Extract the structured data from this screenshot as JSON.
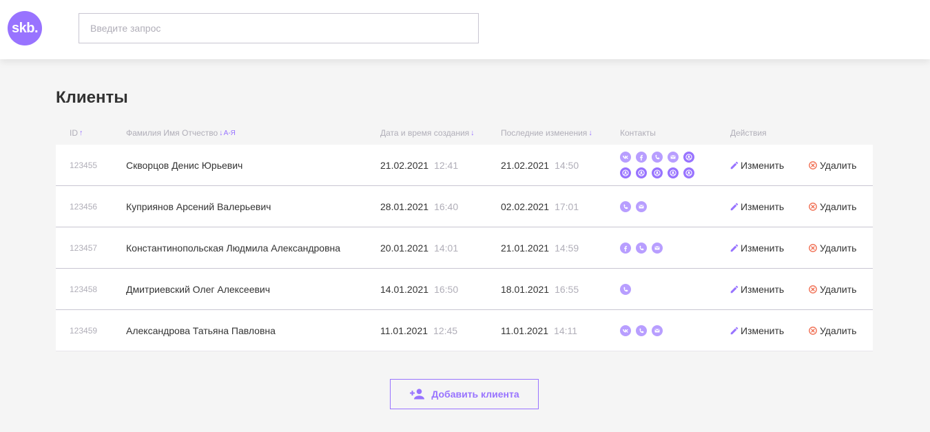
{
  "header": {
    "logo_text": "skb.",
    "search_placeholder": "Введите запрос"
  },
  "page": {
    "title": "Клиенты"
  },
  "table": {
    "columns": {
      "id": "ID",
      "name": "Фамилия Имя Отчество",
      "name_sort_hint": "А-Я",
      "created": "Дата и время создания",
      "updated": "Последние изменения",
      "contacts": "Контакты",
      "actions": "Действия"
    },
    "edit_label": "Изменить",
    "delete_label": "Удалить",
    "rows": [
      {
        "id": "123455",
        "name": "Скворцов Денис Юрьевич",
        "created_date": "21.02.2021",
        "created_time": "12:41",
        "updated_date": "21.02.2021",
        "updated_time": "14:50",
        "contacts": [
          "vk",
          "facebook",
          "phone",
          "mail",
          "other",
          "other",
          "other",
          "other",
          "other",
          "other"
        ]
      },
      {
        "id": "123456",
        "name": "Куприянов Арсений Валерьевич",
        "created_date": "28.01.2021",
        "created_time": "16:40",
        "updated_date": "02.02.2021",
        "updated_time": "17:01",
        "contacts": [
          "phone",
          "mail"
        ]
      },
      {
        "id": "123457",
        "name": "Константинопольская Людмила Александровна",
        "created_date": "20.01.2021",
        "created_time": "14:01",
        "updated_date": "21.01.2021",
        "updated_time": "14:59",
        "contacts": [
          "facebook",
          "phone",
          "mail"
        ]
      },
      {
        "id": "123458",
        "name": "Дмитриевский Олег Алексеевич",
        "created_date": "14.01.2021",
        "created_time": "16:50",
        "updated_date": "18.01.2021",
        "updated_time": "16:55",
        "contacts": [
          "phone"
        ]
      },
      {
        "id": "123459",
        "name": "Александрова Татьяна Павловна",
        "created_date": "11.01.2021",
        "created_time": "12:45",
        "updated_date": "11.01.2021",
        "updated_time": "14:11",
        "contacts": [
          "vk",
          "phone",
          "mail"
        ]
      }
    ]
  },
  "add_button": {
    "label": "Добавить клиента"
  },
  "colors": {
    "accent": "#9873ff",
    "accent_light": "#b89eff",
    "danger": "#f06a4d",
    "muted": "#b0aeb8",
    "border": "#c8c5d1"
  }
}
